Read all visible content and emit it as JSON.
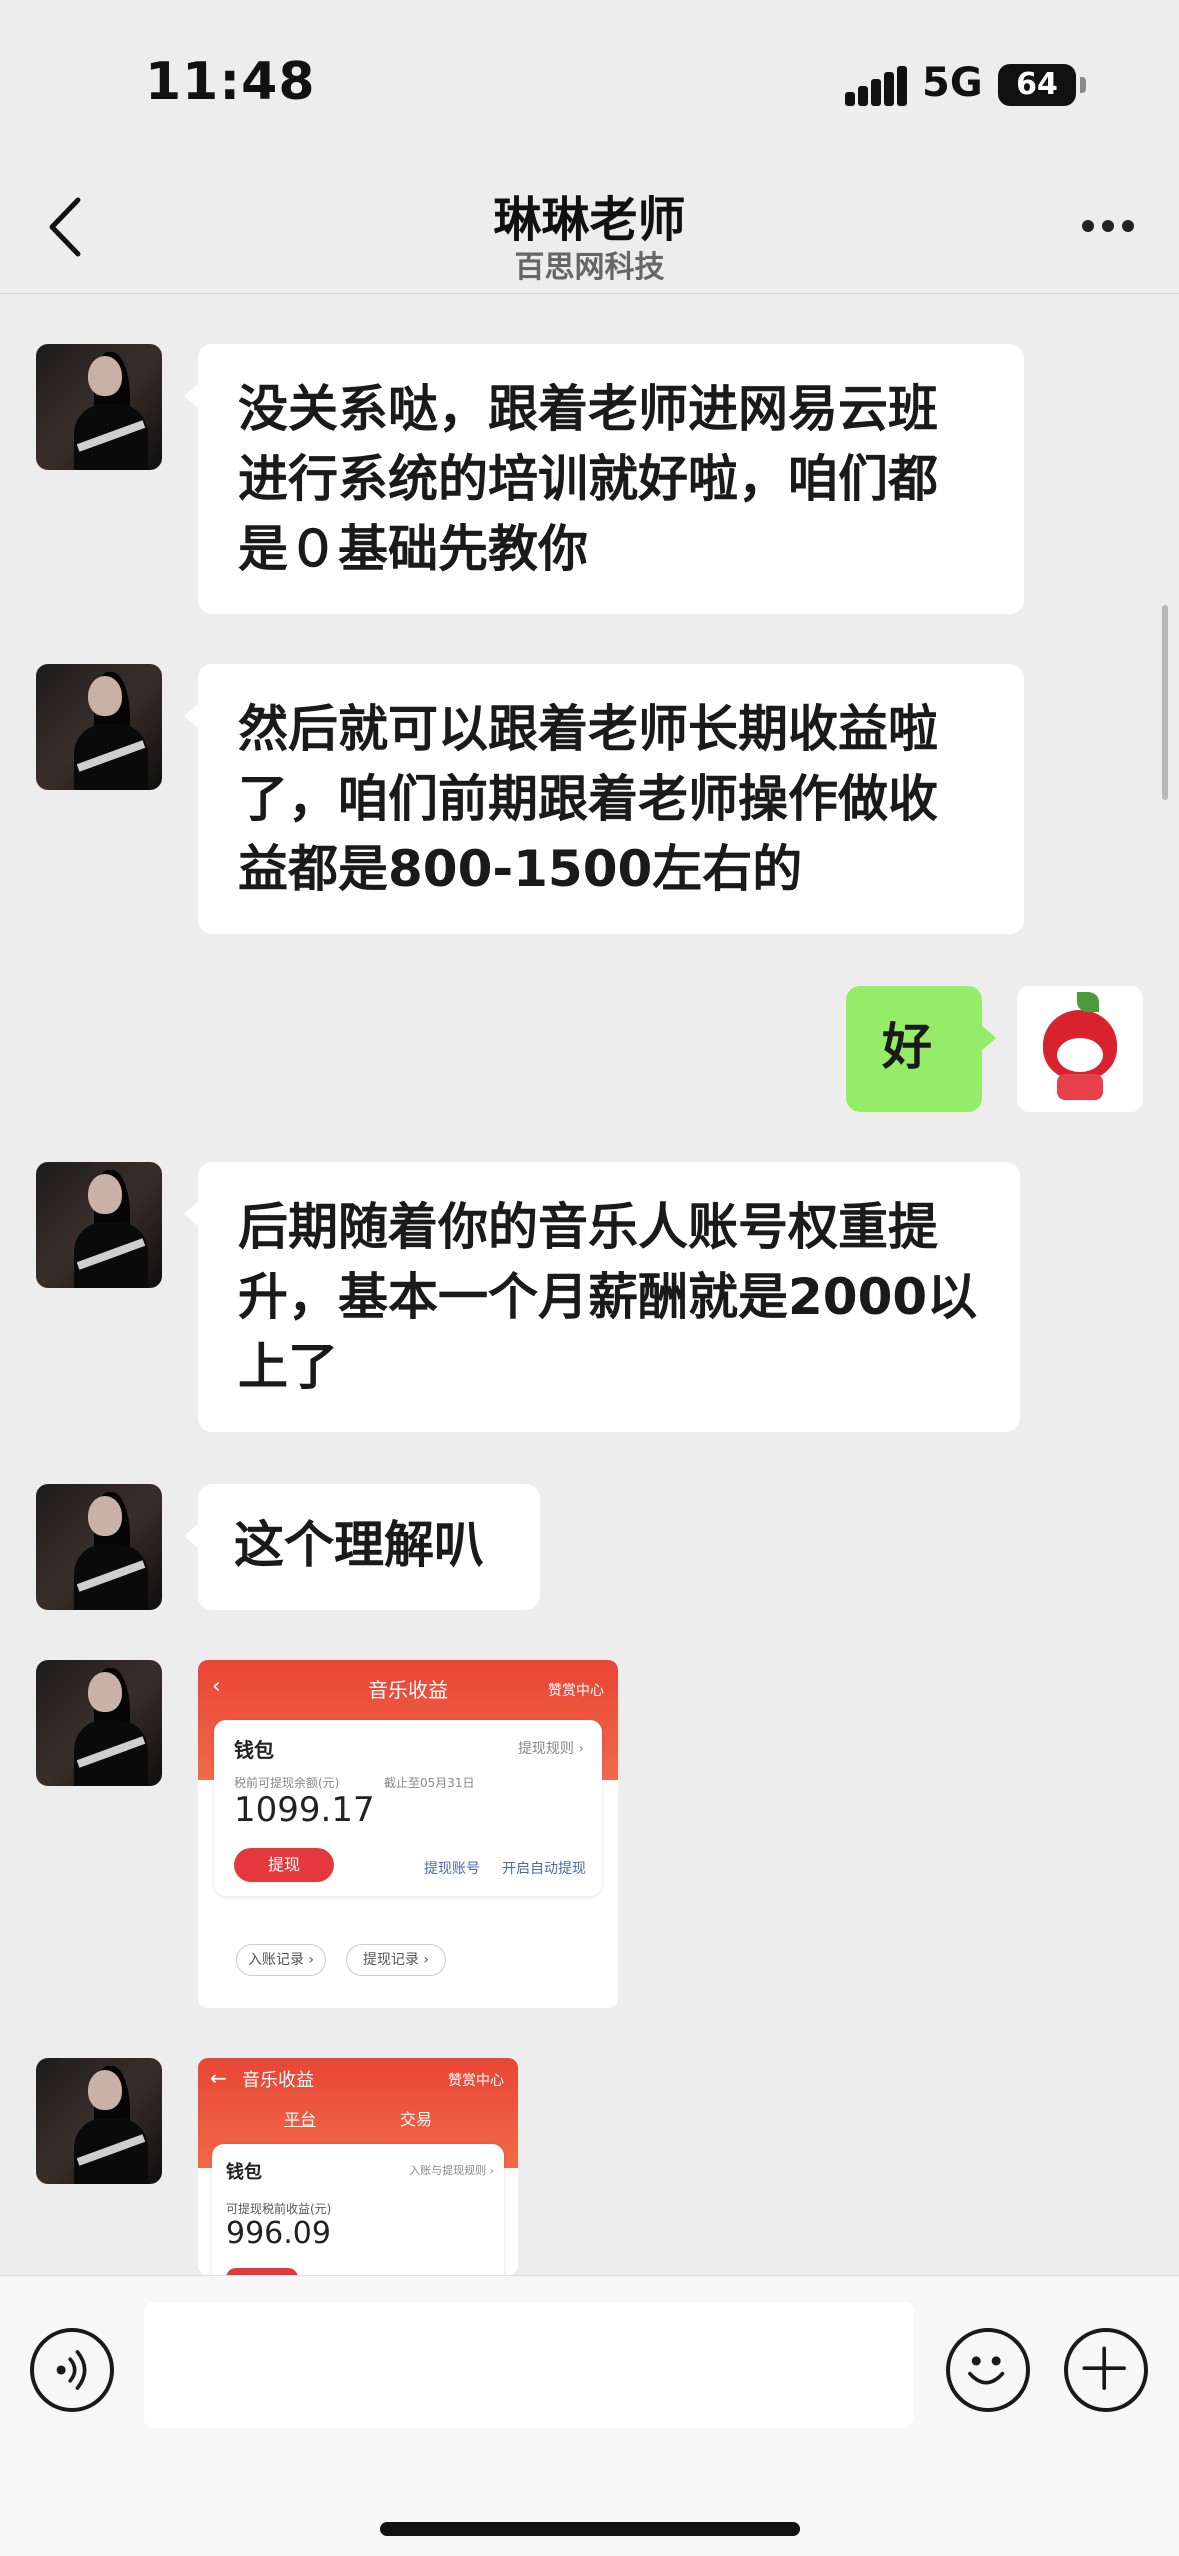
{
  "status_bar": {
    "time": "11:48",
    "network": "5G",
    "battery": "64"
  },
  "header": {
    "title": "琳琳老师",
    "subtitle": "百思网科技"
  },
  "messages": [
    {
      "text": "没关系哒，跟着老师进网易云班进行系统的培训就好啦，咱们都是０基础先教你"
    },
    {
      "text": "然后就可以跟着老师长期收益啦了，咱们前期跟着老师操作做收益都是800-1500左右的"
    },
    {
      "text": "好"
    },
    {
      "text": "后期随着你的音乐人账号权重提升，基本一个月薪酬就是2000以上了"
    },
    {
      "text": "这个理解叭"
    }
  ],
  "image1": {
    "title": "音乐收益",
    "top_right": "赞赏中心",
    "wallet": "钱包",
    "rules": "提现规则 ›",
    "balance_label": "税前可提现余额(元)",
    "cutoff": "截止至05月31日",
    "amount": "1099.17",
    "withdraw": "提现",
    "account": "提现账号",
    "auto": "开启自动提现",
    "record_in": "入账记录 ›",
    "record_out": "提现记录 ›"
  },
  "image2": {
    "title": "音乐收益",
    "top_right": "赞赏中心",
    "tab_platform": "平台",
    "tab_trade": "交易",
    "wallet": "钱包",
    "rules": "入账与提现规则 ›",
    "balance_label": "可提现税前收益(元)",
    "amount": "996.09"
  },
  "colors": {
    "my_bubble": "#95ec69",
    "background": "#ededed",
    "accent_red": "#e84535"
  }
}
